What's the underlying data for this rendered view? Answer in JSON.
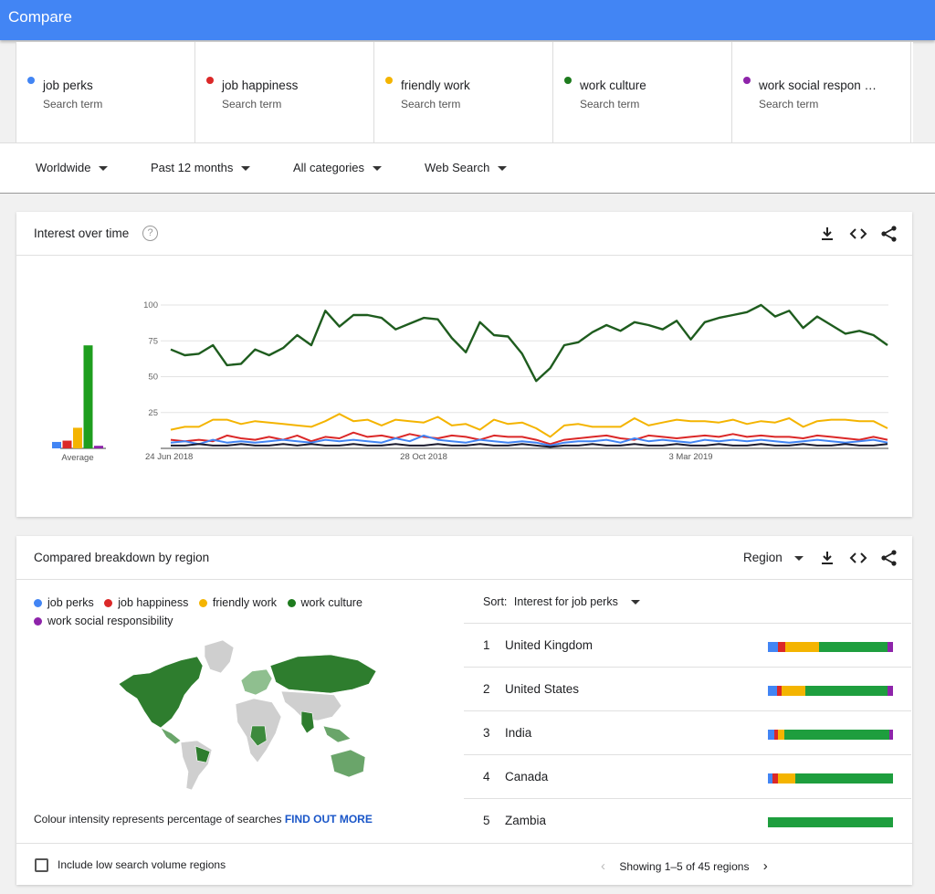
{
  "header": {
    "title": "Compare"
  },
  "terms": [
    {
      "name": "job perks",
      "sub": "Search term",
      "color": "#4285f4"
    },
    {
      "name": "job happiness",
      "sub": "Search term",
      "color": "#db2828"
    },
    {
      "name": "friendly work",
      "sub": "Search term",
      "color": "#f4b400"
    },
    {
      "name": "work culture",
      "sub": "Search term",
      "color": "#1e7b1e"
    },
    {
      "name": "work social respon …",
      "sub": "Search term",
      "color": "#8e24aa"
    }
  ],
  "filters": {
    "region": "Worldwide",
    "time": "Past 12 months",
    "category": "All categories",
    "search_type": "Web Search"
  },
  "interest": {
    "title": "Interest over time",
    "help": "?",
    "average_label": "Average"
  },
  "chart_data": {
    "type": "line",
    "ylim": [
      0,
      100
    ],
    "yticks": [
      "100",
      "75",
      "50",
      "25"
    ],
    "xticks": [
      "24 Jun 2018",
      "28 Oct 2018",
      "3 Mar 2019"
    ],
    "xtick_index": [
      0,
      18,
      37
    ],
    "averages": [
      {
        "name": "job perks",
        "value": 5,
        "color": "#4285f4"
      },
      {
        "name": "job happiness",
        "value": 6,
        "color": "#db2828"
      },
      {
        "name": "friendly work",
        "value": 16,
        "color": "#f4b400"
      },
      {
        "name": "work culture",
        "value": 80,
        "color": "#1e9e1e"
      },
      {
        "name": "work social responsibility",
        "value": 2,
        "color": "#8e24aa"
      }
    ],
    "series": [
      {
        "name": "work culture",
        "color": "#1e5c1e",
        "values": [
          69,
          65,
          66,
          72,
          58,
          59,
          69,
          65,
          70,
          79,
          72,
          96,
          85,
          93,
          93,
          91,
          83,
          87,
          91,
          90,
          77,
          67,
          88,
          79,
          78,
          66,
          47,
          56,
          72,
          74,
          81,
          86,
          82,
          88,
          86,
          83,
          89,
          76,
          88,
          91,
          93,
          95,
          100,
          92,
          96,
          84,
          92,
          86,
          80,
          82,
          79,
          72
        ]
      },
      {
        "name": "friendly work",
        "color": "#f4b400",
        "values": [
          13,
          15,
          15,
          20,
          20,
          17,
          19,
          18,
          17,
          16,
          15,
          19,
          24,
          19,
          20,
          16,
          20,
          19,
          18,
          22,
          16,
          17,
          13,
          20,
          17,
          18,
          14,
          8,
          16,
          17,
          15,
          15,
          15,
          21,
          16,
          18,
          20,
          19,
          19,
          18,
          20,
          17,
          19,
          18,
          21,
          15,
          19,
          20,
          20,
          19,
          19,
          14
        ]
      },
      {
        "name": "job happiness",
        "color": "#db2828",
        "values": [
          6,
          5,
          6,
          5,
          9,
          7,
          6,
          8,
          6,
          9,
          5,
          8,
          7,
          11,
          8,
          9,
          7,
          10,
          8,
          7,
          9,
          8,
          6,
          9,
          8,
          8,
          6,
          3,
          6,
          7,
          8,
          9,
          7,
          6,
          9,
          8,
          7,
          8,
          9,
          8,
          10,
          8,
          9,
          8,
          8,
          7,
          9,
          8,
          7,
          6,
          8,
          6
        ]
      },
      {
        "name": "job perks",
        "color": "#4285f4",
        "values": [
          4,
          5,
          3,
          6,
          4,
          5,
          4,
          5,
          6,
          5,
          4,
          6,
          5,
          6,
          5,
          4,
          7,
          5,
          9,
          6,
          5,
          4,
          6,
          5,
          4,
          5,
          4,
          2,
          4,
          5,
          5,
          6,
          4,
          7,
          5,
          6,
          5,
          4,
          6,
          5,
          6,
          5,
          6,
          5,
          4,
          5,
          6,
          5,
          4,
          5,
          6,
          4
        ]
      },
      {
        "name": "work social responsibility",
        "color": "#1a1a2e",
        "values": [
          2,
          2,
          3,
          2,
          2,
          3,
          2,
          2,
          3,
          2,
          3,
          2,
          2,
          3,
          2,
          2,
          3,
          2,
          2,
          3,
          2,
          2,
          3,
          2,
          2,
          3,
          2,
          1,
          2,
          2,
          3,
          2,
          2,
          3,
          2,
          2,
          3,
          2,
          2,
          3,
          2,
          2,
          3,
          2,
          2,
          3,
          2,
          2,
          3,
          2,
          2,
          3
        ]
      }
    ]
  },
  "region": {
    "title": "Compared breakdown by region",
    "dropdown": "Region",
    "legend": [
      {
        "label": "job perks",
        "color": "#4285f4"
      },
      {
        "label": "job happiness",
        "color": "#db2828"
      },
      {
        "label": "friendly work",
        "color": "#f4b400"
      },
      {
        "label": "work culture",
        "color": "#1e7b1e"
      },
      {
        "label": "work social responsibility",
        "color": "#8e24aa"
      }
    ],
    "sort_label": "Sort:",
    "sort_value": "Interest for job perks",
    "map_note": "Colour intensity represents percentage of searches",
    "find_out_more": "FIND OUT MORE",
    "include_low": "Include low search volume regions",
    "pager_text": "Showing 1–5 of 45 regions",
    "rows": [
      {
        "rank": "1",
        "name": "United Kingdom",
        "shares": [
          8,
          5,
          26,
          53,
          4
        ]
      },
      {
        "rank": "2",
        "name": "United States",
        "shares": [
          7,
          4,
          19,
          66,
          4
        ]
      },
      {
        "rank": "3",
        "name": "India",
        "shares": [
          5,
          3,
          5,
          84,
          3
        ]
      },
      {
        "rank": "4",
        "name": "Canada",
        "shares": [
          4,
          4,
          14,
          78,
          0
        ]
      },
      {
        "rank": "5",
        "name": "Zambia",
        "shares": [
          0,
          0,
          0,
          100,
          0
        ]
      }
    ],
    "bar_colors": [
      "#4285f4",
      "#db2828",
      "#f4b400",
      "#1e9e3e",
      "#8e24aa"
    ]
  }
}
